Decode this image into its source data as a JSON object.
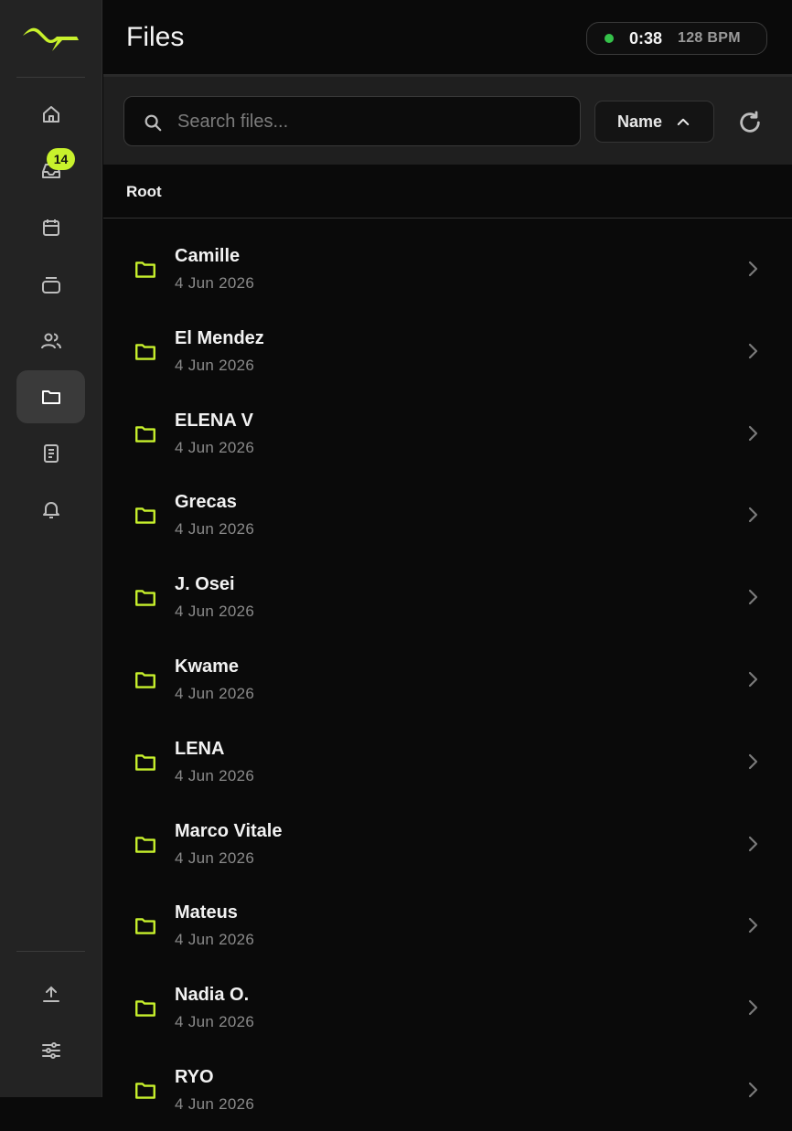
{
  "app": {
    "page_title": "Files",
    "accent_color": "#c8f12c"
  },
  "timer": {
    "time": "0:38",
    "bpm": "128 BPM",
    "status_color": "#35c24a"
  },
  "sidebar": {
    "logo": "brand-logo",
    "inbox_badge": "14",
    "items": [
      {
        "icon": "home-icon"
      },
      {
        "icon": "inbox-icon"
      },
      {
        "icon": "calendar-icon"
      },
      {
        "icon": "archive-icon"
      },
      {
        "icon": "users-icon"
      },
      {
        "icon": "folder-icon",
        "active": true
      },
      {
        "icon": "document-icon"
      },
      {
        "icon": "bell-icon"
      }
    ],
    "bottom_items": [
      {
        "icon": "upload-icon"
      },
      {
        "icon": "sliders-icon"
      }
    ]
  },
  "toolbar": {
    "search_placeholder": "Search files...",
    "search_value": "",
    "sort_label": "Name",
    "sort_direction": "ascending"
  },
  "breadcrumb": {
    "root": "Root"
  },
  "files": [
    {
      "name": "Camille",
      "date": "4 Jun 2026"
    },
    {
      "name": "El Mendez",
      "date": "4 Jun 2026"
    },
    {
      "name": "ELENA V",
      "date": "4 Jun 2026"
    },
    {
      "name": "Grecas",
      "date": "4 Jun 2026"
    },
    {
      "name": "J. Osei",
      "date": "4 Jun 2026"
    },
    {
      "name": "Kwame",
      "date": "4 Jun 2026"
    },
    {
      "name": "LENA",
      "date": "4 Jun 2026"
    },
    {
      "name": "Marco Vitale",
      "date": "4 Jun 2026"
    },
    {
      "name": "Mateus",
      "date": "4 Jun 2026"
    },
    {
      "name": "Nadia O.",
      "date": "4 Jun 2026"
    },
    {
      "name": "RYO",
      "date": "4 Jun 2026"
    }
  ]
}
